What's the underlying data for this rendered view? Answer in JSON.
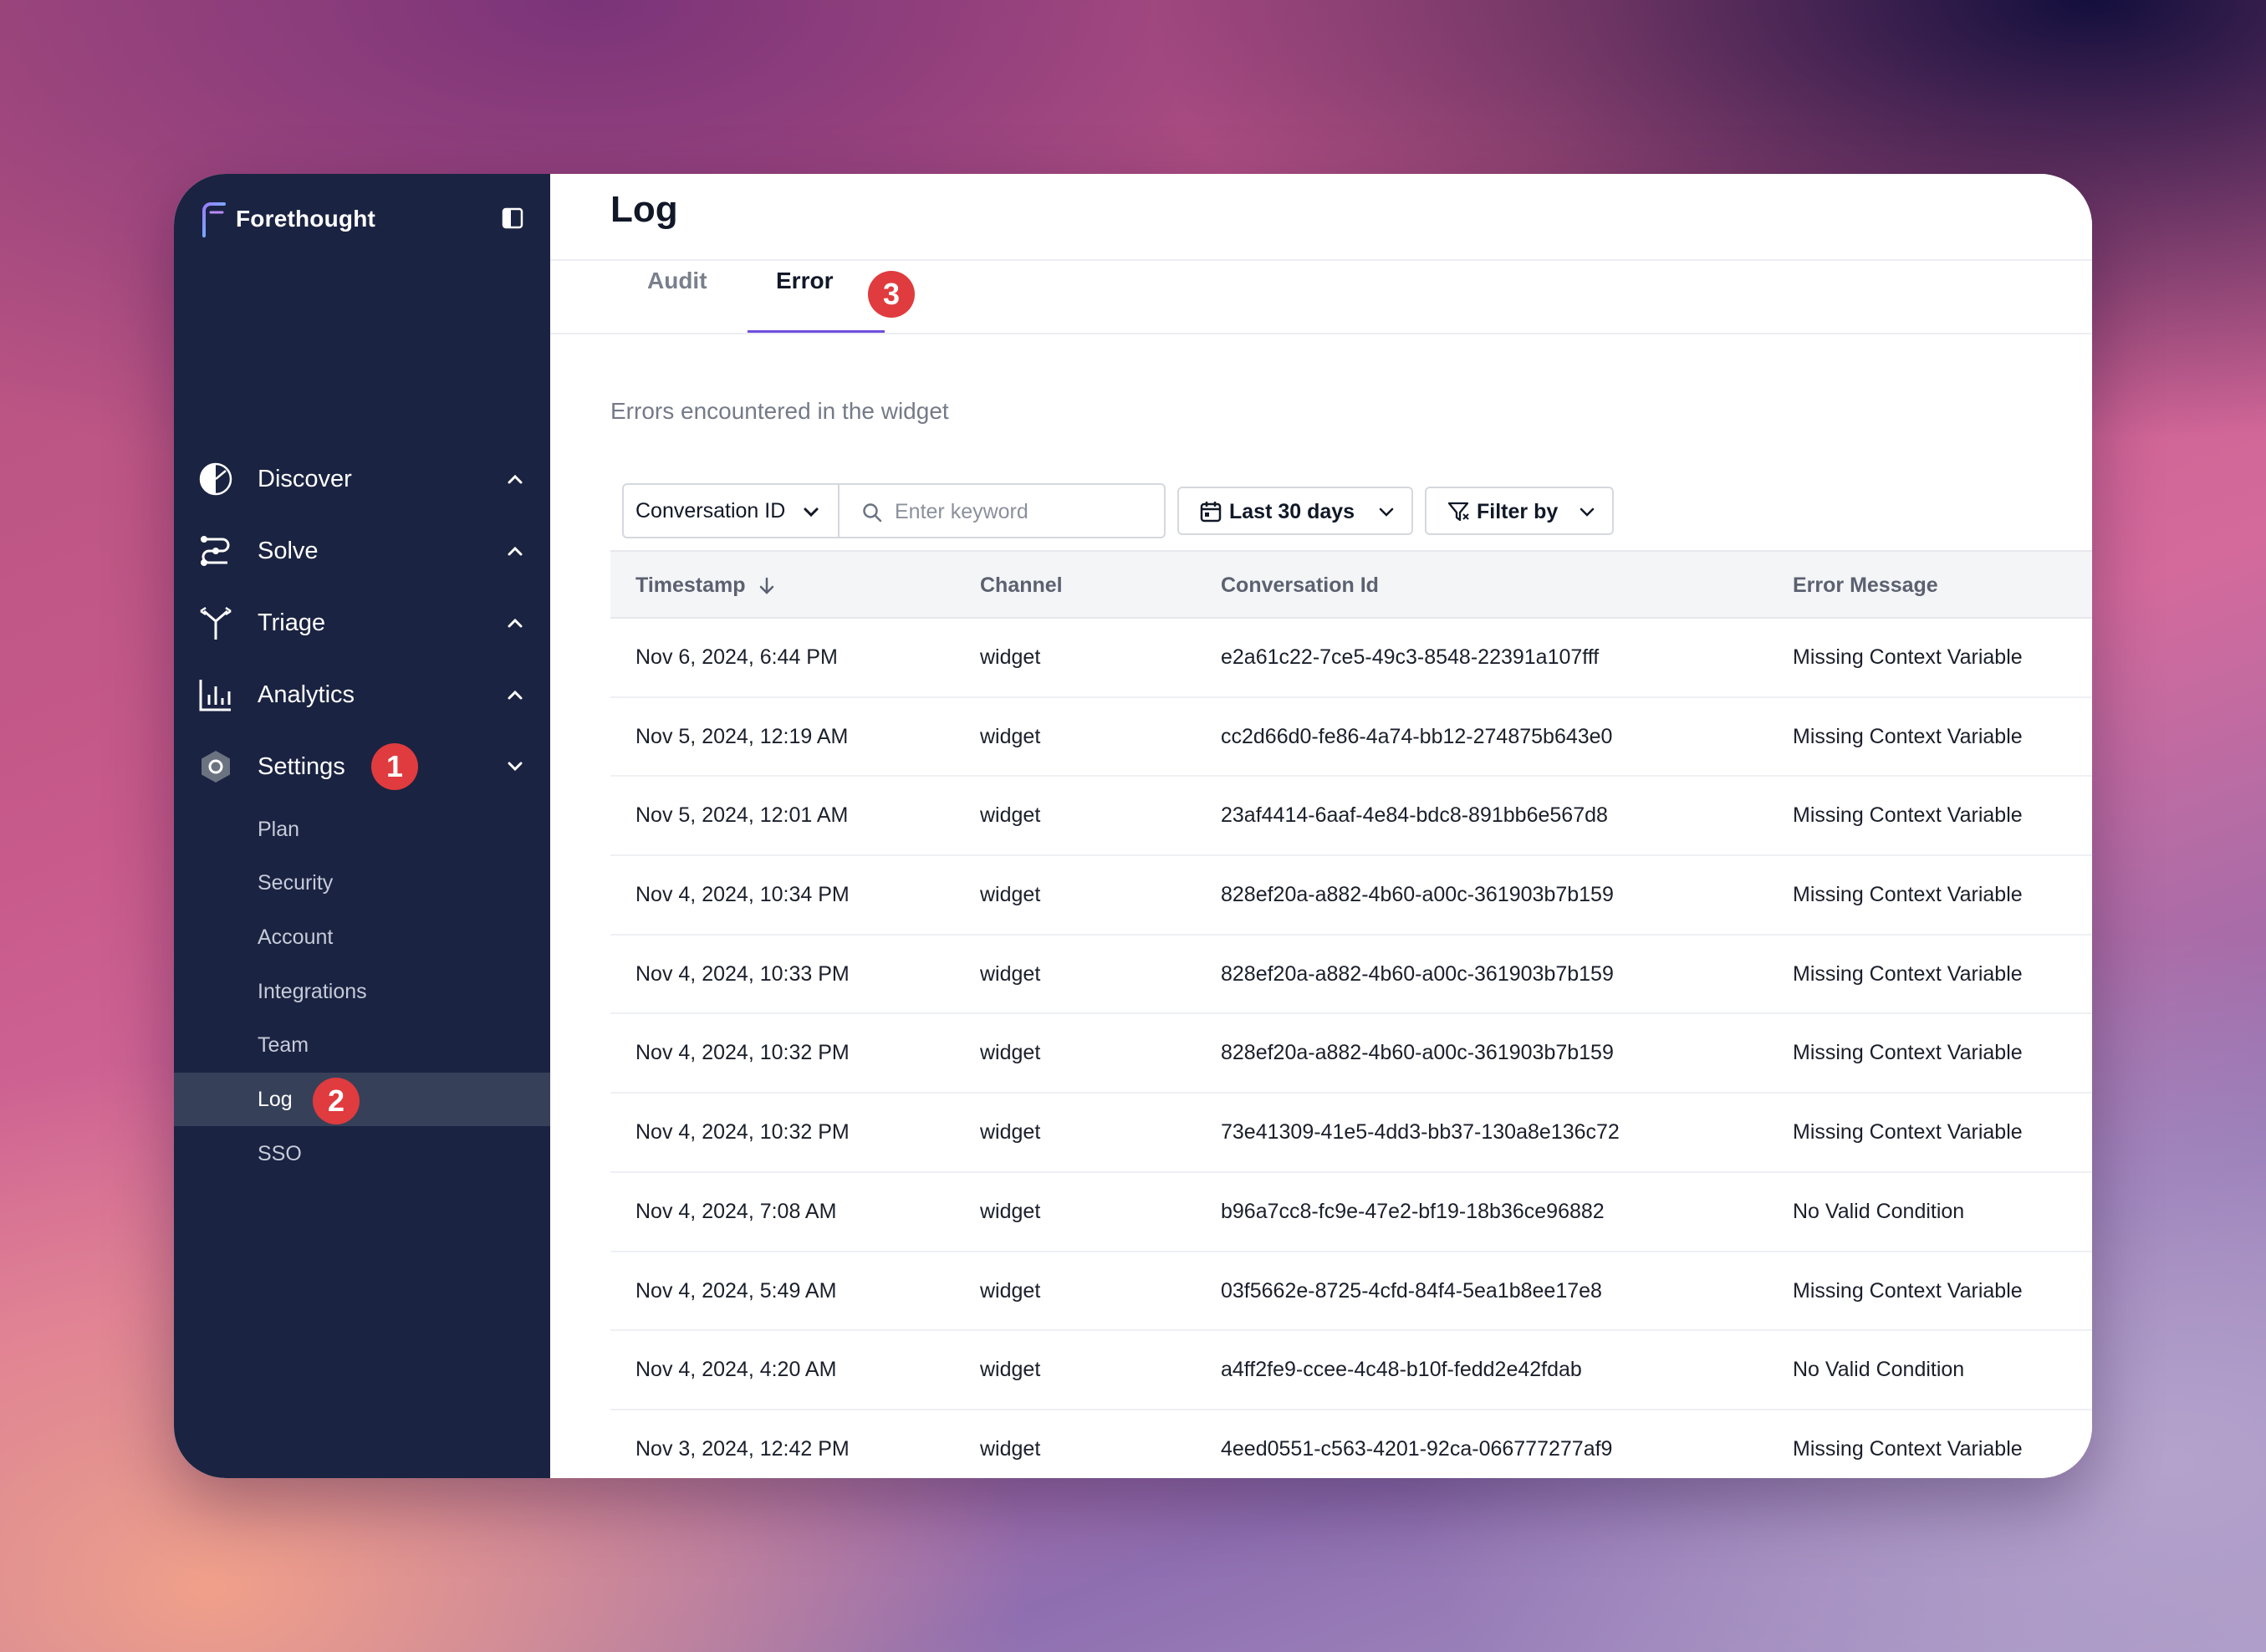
{
  "brand": {
    "name": "Forethought"
  },
  "sidebar": {
    "nav": [
      {
        "label": "Discover",
        "icon": "discover-icon"
      },
      {
        "label": "Solve",
        "icon": "solve-icon"
      },
      {
        "label": "Triage",
        "icon": "triage-icon"
      },
      {
        "label": "Analytics",
        "icon": "analytics-icon"
      },
      {
        "label": "Settings",
        "icon": "settings-icon"
      }
    ],
    "settings_sub": [
      "Plan",
      "Security",
      "Account",
      "Integrations",
      "Team",
      "Log",
      "SSO"
    ],
    "active_sub": "Log"
  },
  "annotations": {
    "badge1": "1",
    "badge2": "2",
    "badge3": "3"
  },
  "page": {
    "title": "Log",
    "tabs": [
      {
        "label": "Audit"
      },
      {
        "label": "Error"
      }
    ],
    "active_tab": "Error",
    "subtitle": "Errors encountered in the widget"
  },
  "toolbar": {
    "search_field_select": "Conversation ID",
    "search_placeholder": "Enter keyword",
    "search_value": "",
    "date_range": "Last 30 days",
    "filter_label": "Filter by"
  },
  "table": {
    "columns": [
      "Timestamp",
      "Channel",
      "Conversation Id",
      "Error Message"
    ],
    "sort": {
      "column": "Timestamp",
      "direction": "desc"
    },
    "rows": [
      [
        "Nov 6, 2024, 6:44 PM",
        "widget",
        "e2a61c22-7ce5-49c3-8548-22391a107fff",
        "Missing Context Variable"
      ],
      [
        "Nov 5, 2024, 12:19 AM",
        "widget",
        "cc2d66d0-fe86-4a74-bb12-274875b643e0",
        "Missing Context Variable"
      ],
      [
        "Nov 5, 2024, 12:01 AM",
        "widget",
        "23af4414-6aaf-4e84-bdc8-891bb6e567d8",
        "Missing Context Variable"
      ],
      [
        "Nov 4, 2024, 10:34 PM",
        "widget",
        "828ef20a-a882-4b60-a00c-361903b7b159",
        "Missing Context Variable"
      ],
      [
        "Nov 4, 2024, 10:33 PM",
        "widget",
        "828ef20a-a882-4b60-a00c-361903b7b159",
        "Missing Context Variable"
      ],
      [
        "Nov 4, 2024, 10:32 PM",
        "widget",
        "828ef20a-a882-4b60-a00c-361903b7b159",
        "Missing Context Variable"
      ],
      [
        "Nov 4, 2024, 10:32 PM",
        "widget",
        "73e41309-41e5-4dd3-bb37-130a8e136c72",
        "Missing Context Variable"
      ],
      [
        "Nov 4, 2024, 7:08 AM",
        "widget",
        "b96a7cc8-fc9e-47e2-bf19-18b36ce96882",
        "No Valid Condition"
      ],
      [
        "Nov 4, 2024, 5:49 AM",
        "widget",
        "03f5662e-8725-4cfd-84f4-5ea1b8ee17e8",
        "Missing Context Variable"
      ],
      [
        "Nov 4, 2024, 4:20 AM",
        "widget",
        "a4ff2fe9-ccee-4c48-b10f-fedd2e42fdab",
        "No Valid Condition"
      ],
      [
        "Nov 3, 2024, 12:42 PM",
        "widget",
        "4eed0551-c563-4201-92ca-066777277af9",
        "Missing Context Variable"
      ]
    ]
  },
  "colors": {
    "sidebar_bg": "#1a2341",
    "sidebar_active": "#374059",
    "accent": "#6f4ee0",
    "badge": "#e03b3e"
  }
}
